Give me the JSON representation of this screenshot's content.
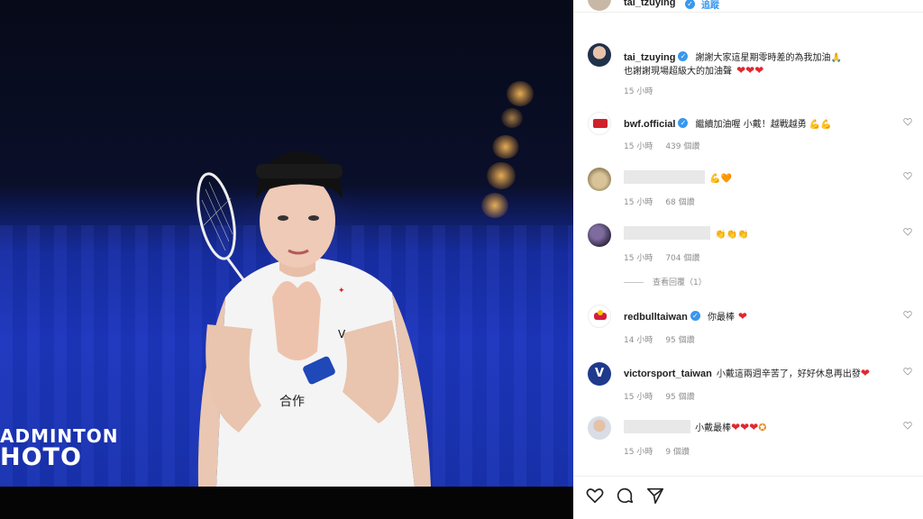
{
  "post": {
    "watermark_line1": "ADMINTON",
    "watermark_line2": "HOTO"
  },
  "header": {
    "username": "tai_tzuying",
    "follow_label": "追蹤"
  },
  "caption": {
    "username": "tai_tzuying",
    "line1": "謝謝大家這星期零時差的為我加油🙏",
    "line2": "也謝謝現場超級大的加油聲",
    "hearts": "❤❤❤",
    "time": "15 小時"
  },
  "comments": [
    {
      "username": "bwf.official",
      "verified": true,
      "text": "繼續加油喔 小戴！越戰越勇 💪💪",
      "time": "15 小時",
      "likes": "439 個讚"
    },
    {
      "username": "",
      "verified": false,
      "text": "💪🧡",
      "time": "15 小時",
      "likes": "68 個讚"
    },
    {
      "username": "",
      "verified": false,
      "text": "👏👏👏",
      "time": "15 小時",
      "likes": "704 個讚",
      "replies": "查看回覆（1）"
    },
    {
      "username": "redbulltaiwan",
      "verified": true,
      "text": "你最棒",
      "time": "14 小時",
      "likes": "95 個讚"
    },
    {
      "username": "victorsport_taiwan",
      "verified": false,
      "text": "小戴這兩週辛苦了，好好休息再出發",
      "time": "15 小時",
      "likes": "95 個讚"
    },
    {
      "username": "",
      "verified": false,
      "text": "小戴最棒",
      "time": "15 小時",
      "likes": "9 個讚"
    }
  ],
  "colors": {
    "verified": "#3897f0",
    "heart": "#e0282e",
    "meta": "#8e8e8e"
  }
}
